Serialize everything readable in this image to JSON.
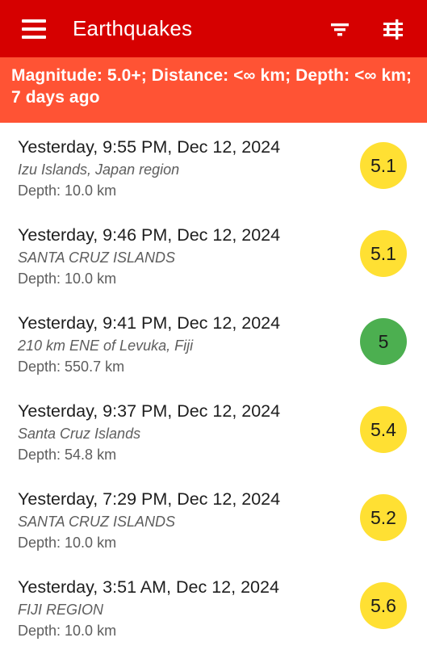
{
  "appbar": {
    "title": "Earthquakes",
    "menu_icon": "hamburger-menu-icon",
    "sort_icon": "filter-list-icon",
    "tune_icon": "tune-sliders-icon",
    "background_color": "#d60000",
    "foreground_color": "#ffffff"
  },
  "filter_banner": {
    "text": "Magnitude: 5.0+; Distance: <∞ km; Depth: <∞ km; 7 days ago",
    "background_color": "#ff5334",
    "text_color": "#ffffff"
  },
  "colors": {
    "magnitude_yellow": "#ffe033",
    "magnitude_green": "#4caf50",
    "primary_text": "#1e1e1e",
    "secondary_text": "#5d5d5d",
    "page_background": "#ffffff"
  },
  "list": {
    "items": [
      {
        "time": "Yesterday, 9:55 PM, Dec 12, 2024",
        "place": "Izu Islands, Japan region",
        "depth": "Depth: 10.0 km",
        "magnitude": "5.1",
        "badge_color": "#ffe033"
      },
      {
        "time": "Yesterday, 9:46 PM, Dec 12, 2024",
        "place": "SANTA CRUZ ISLANDS",
        "depth": "Depth: 10.0 km",
        "magnitude": "5.1",
        "badge_color": "#ffe033"
      },
      {
        "time": "Yesterday, 9:41 PM, Dec 12, 2024",
        "place": "210 km ENE of Levuka, Fiji",
        "depth": "Depth: 550.7 km",
        "magnitude": "5",
        "badge_color": "#4caf50"
      },
      {
        "time": "Yesterday, 9:37 PM, Dec 12, 2024",
        "place": "Santa Cruz Islands",
        "depth": "Depth: 54.8 km",
        "magnitude": "5.4",
        "badge_color": "#ffe033"
      },
      {
        "time": "Yesterday, 7:29 PM, Dec 12, 2024",
        "place": "SANTA CRUZ ISLANDS",
        "depth": "Depth: 10.0 km",
        "magnitude": "5.2",
        "badge_color": "#ffe033"
      },
      {
        "time": "Yesterday, 3:51 AM, Dec 12, 2024",
        "place": "FIJI REGION",
        "depth": "Depth: 10.0 km",
        "magnitude": "5.6",
        "badge_color": "#ffe033"
      }
    ]
  }
}
